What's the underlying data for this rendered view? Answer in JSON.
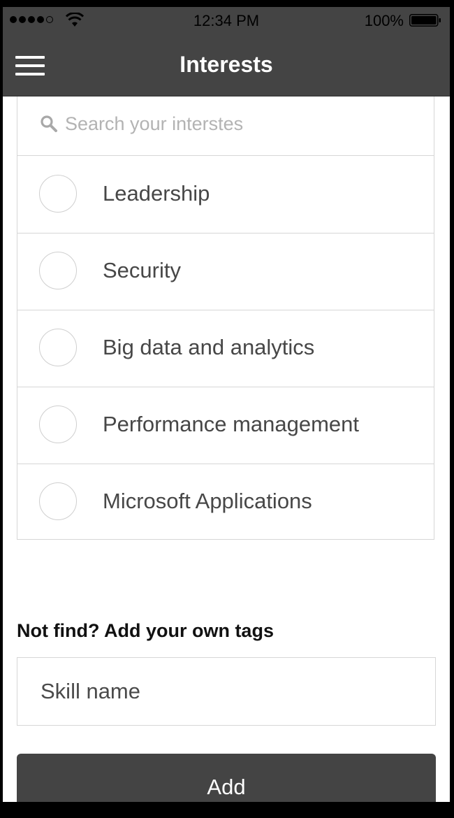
{
  "status_bar": {
    "time": "12:34 PM",
    "battery_percent": "100%",
    "signal_strength": 4,
    "signal_icon": "signal-dots-icon",
    "wifi_icon": "wifi-icon",
    "battery_icon": "battery-icon"
  },
  "nav": {
    "title": "Interests",
    "menu_icon": "hamburger-menu-icon"
  },
  "search": {
    "placeholder": "Search your interstes",
    "value": "",
    "icon": "search-icon"
  },
  "interests": [
    {
      "label": "Leadership",
      "selected": false
    },
    {
      "label": "Security",
      "selected": false
    },
    {
      "label": "Big data and analytics",
      "selected": false
    },
    {
      "label": "Performance management",
      "selected": false
    },
    {
      "label": "Microsoft Applications",
      "selected": false
    }
  ],
  "custom_tags": {
    "heading": "Not find? Add your own tags",
    "input_placeholder": "Skill name",
    "input_value": "",
    "add_button_label": "Add"
  },
  "colors": {
    "header_bg": "#444444",
    "button_bg": "#444444",
    "border": "#d6d6d6",
    "text_primary": "#474747",
    "placeholder": "#b3b3b3"
  }
}
